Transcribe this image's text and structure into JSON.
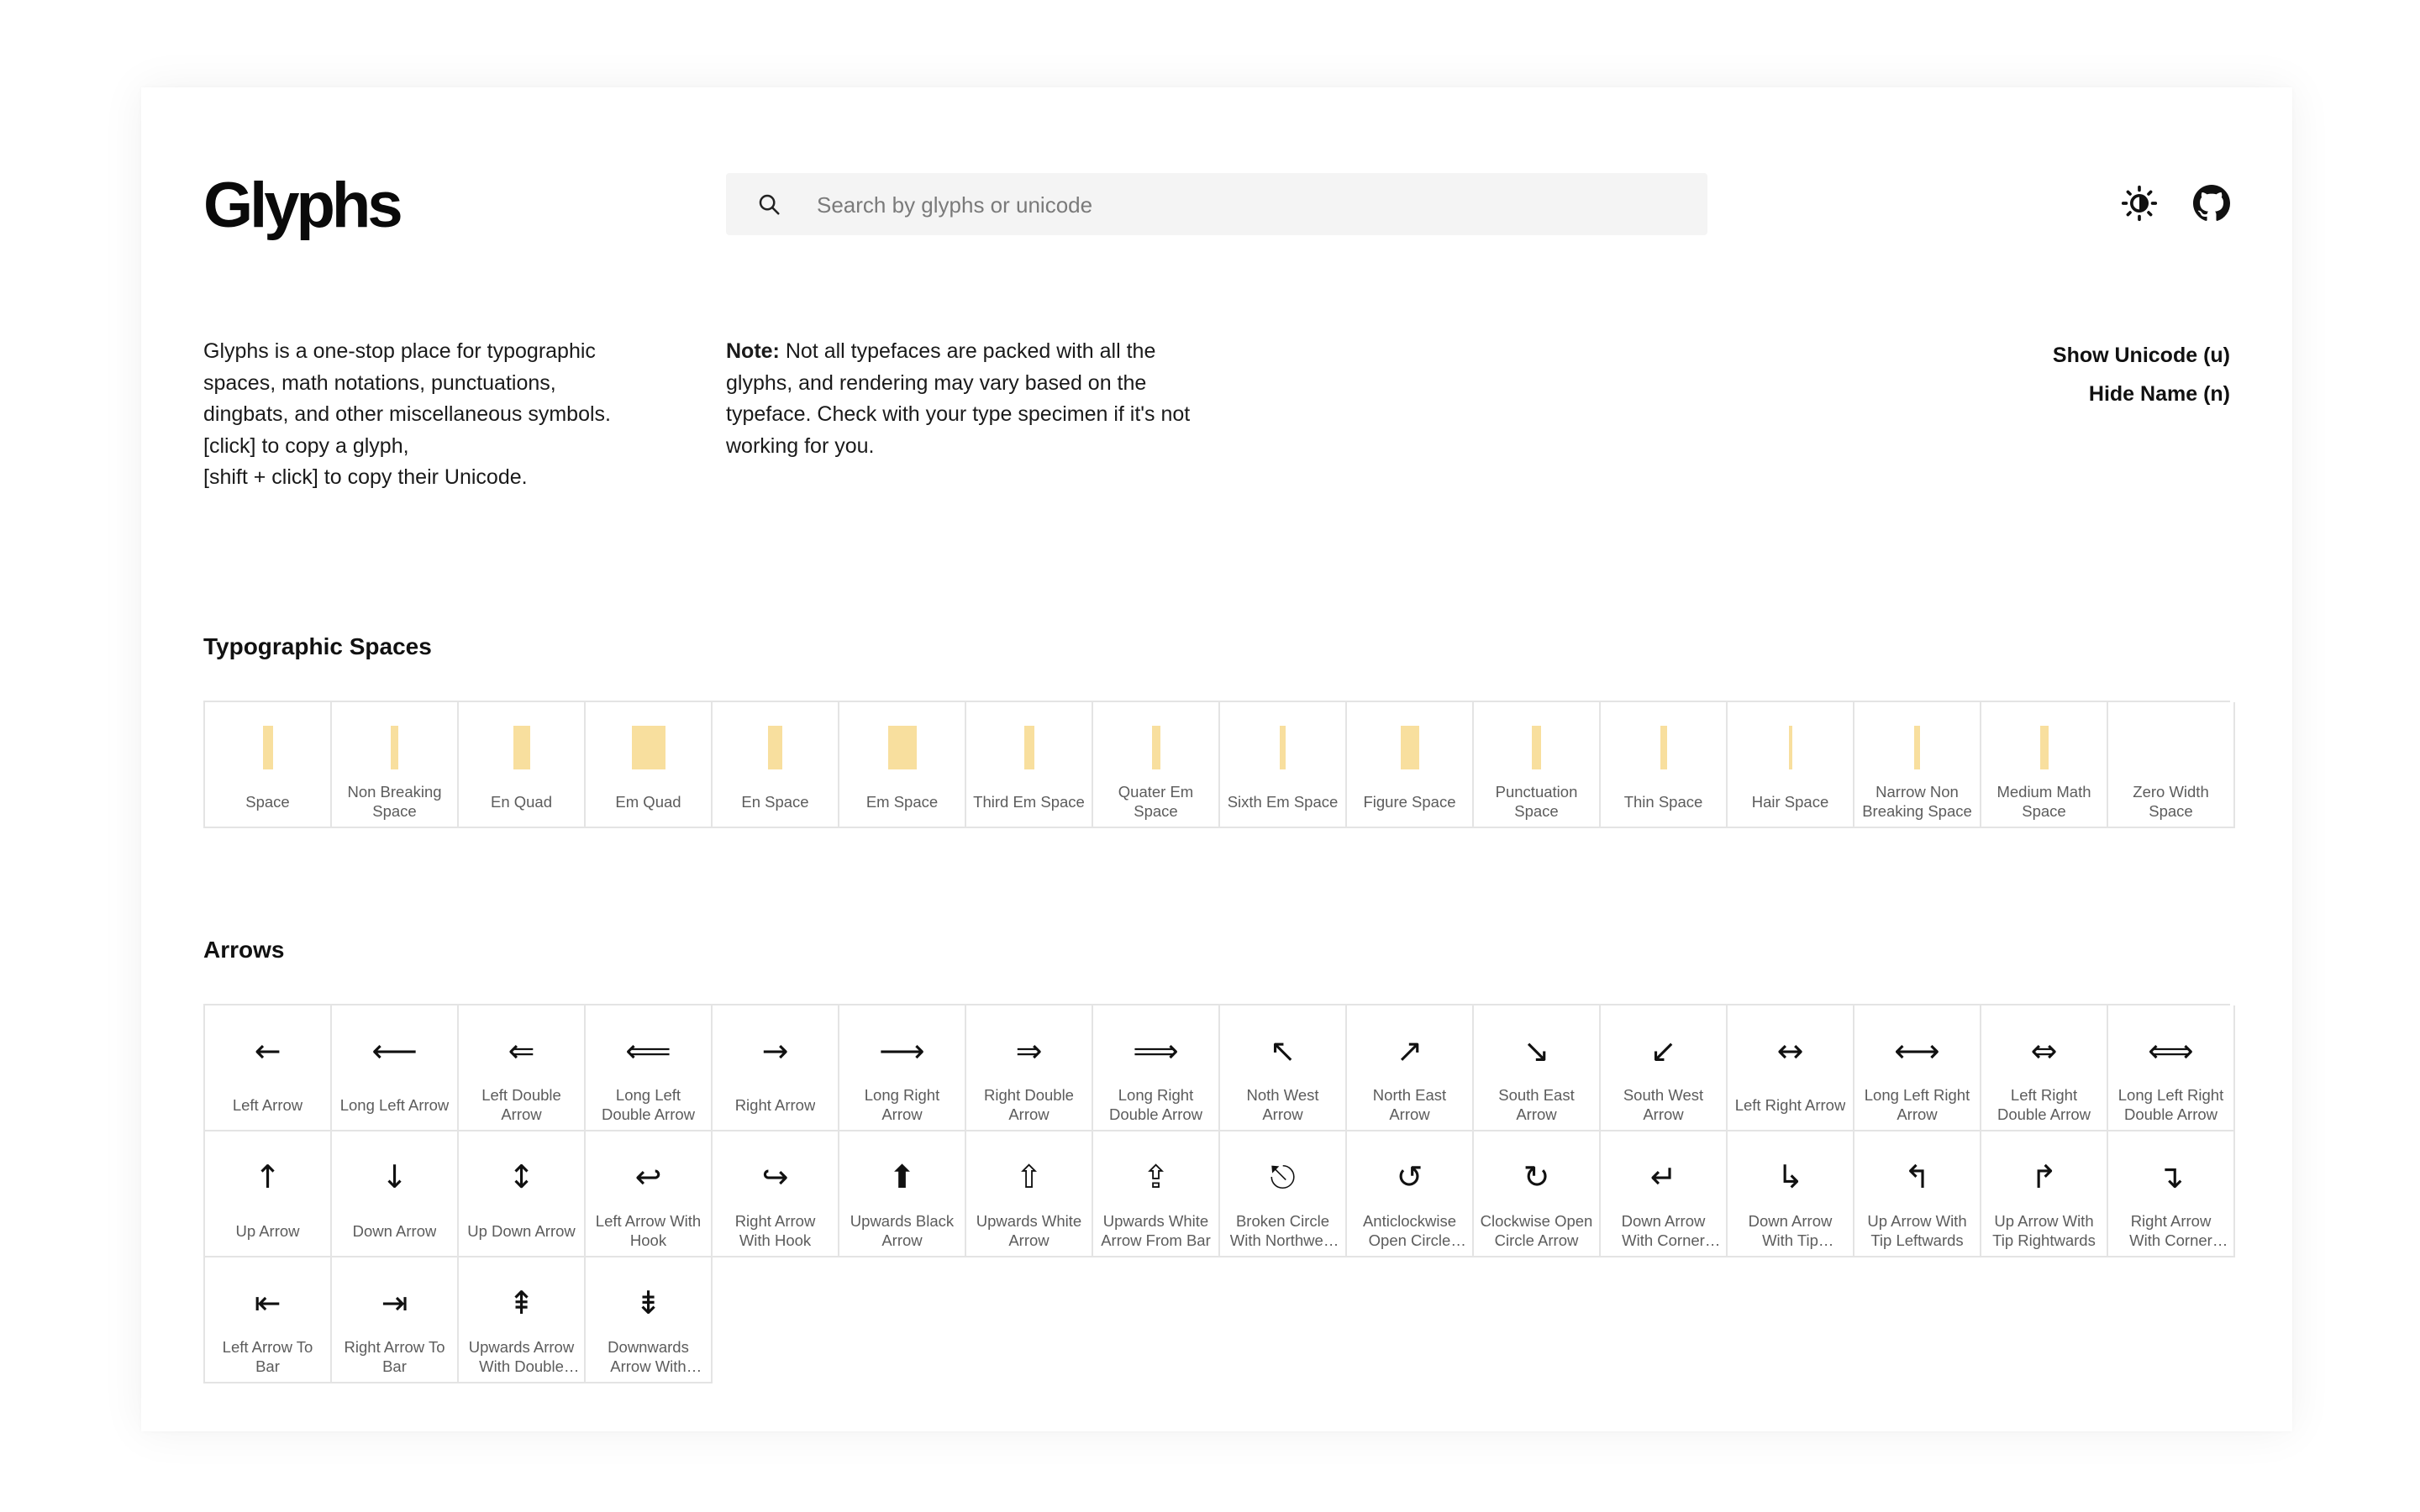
{
  "app": {
    "logo": "Glyphs"
  },
  "search": {
    "placeholder": "Search by glyphs or unicode"
  },
  "header": {
    "theme_icon": "sun-contrast-icon",
    "github_icon": "github-icon"
  },
  "intro": {
    "lines": [
      "Glyphs is a one-stop place for typographic",
      "spaces, math notations, punctuations,",
      "dingbats, and other miscellaneous symbols.",
      "[click] to copy a glyph,",
      "[shift + click] to copy their Unicode."
    ]
  },
  "note": {
    "label": "Note:",
    "text": "Not all typefaces are packed with all the glyphs, and rendering may vary based on the typeface. Check with your type specimen if it's not working for you."
  },
  "toggles": {
    "show_unicode": "Show Unicode (u)",
    "hide_name": "Hide Name (n)"
  },
  "colors": {
    "space_fill": "#f8df9e",
    "grid_border": "#e4e4e4"
  },
  "sections": [
    {
      "title": "Typographic Spaces",
      "kind": "spaces",
      "items": [
        {
          "name": "Space",
          "glyph": " "
        },
        {
          "name": "Non Breaking Space",
          "glyph": " "
        },
        {
          "name": "En Quad",
          "glyph": " "
        },
        {
          "name": "Em Quad",
          "glyph": " "
        },
        {
          "name": "En Space",
          "glyph": " "
        },
        {
          "name": "Em Space",
          "glyph": " "
        },
        {
          "name": "Third Em Space",
          "glyph": " "
        },
        {
          "name": "Quater Em Space",
          "glyph": " "
        },
        {
          "name": "Sixth Em Space",
          "glyph": " "
        },
        {
          "name": "Figure Space",
          "glyph": " "
        },
        {
          "name": "Punctuation Space",
          "glyph": " "
        },
        {
          "name": "Thin Space",
          "glyph": " "
        },
        {
          "name": "Hair Space",
          "glyph": " "
        },
        {
          "name": "Narrow Non Breaking Space",
          "glyph": " "
        },
        {
          "name": "Medium Math Space",
          "glyph": " "
        },
        {
          "name": "Zero Width Space",
          "glyph": "​"
        }
      ]
    },
    {
      "title": "Arrows",
      "kind": "glyphs",
      "items": [
        {
          "name": "Left Arrow",
          "glyph": "←"
        },
        {
          "name": "Long Left Arrow",
          "glyph": "⟵"
        },
        {
          "name": "Left Double Arrow",
          "glyph": "⇐"
        },
        {
          "name": "Long Left Double Arrow",
          "glyph": "⟸"
        },
        {
          "name": "Right Arrow",
          "glyph": "→"
        },
        {
          "name": "Long Right Arrow",
          "glyph": "⟶"
        },
        {
          "name": "Right Double Arrow",
          "glyph": "⇒"
        },
        {
          "name": "Long Right Double Arrow",
          "glyph": "⟹"
        },
        {
          "name": "Noth West Arrow",
          "glyph": "↖"
        },
        {
          "name": "North East Arrow",
          "glyph": "↗"
        },
        {
          "name": "South East Arrow",
          "glyph": "↘"
        },
        {
          "name": "South West Arrow",
          "glyph": "↙"
        },
        {
          "name": "Left Right Arrow",
          "glyph": "↔"
        },
        {
          "name": "Long Left Right Arrow",
          "glyph": "⟷"
        },
        {
          "name": "Left Right Double Arrow",
          "glyph": "⇔"
        },
        {
          "name": "Long Left Right Double Arrow",
          "glyph": "⟺"
        },
        {
          "name": "Up Arrow",
          "glyph": "↑"
        },
        {
          "name": "Down Arrow",
          "glyph": "↓"
        },
        {
          "name": "Up Down Arrow",
          "glyph": "↕"
        },
        {
          "name": "Left Arrow With Hook",
          "glyph": "↩"
        },
        {
          "name": "Right Arrow With Hook",
          "glyph": "↪"
        },
        {
          "name": "Upwards Black Arrow",
          "glyph": "⬆"
        },
        {
          "name": "Upwards White Arrow",
          "glyph": "⇧"
        },
        {
          "name": "Upwards White Arrow From Bar",
          "glyph": "⇪"
        },
        {
          "name": "Broken Circle With Northwest Arrow",
          "glyph": "⎋"
        },
        {
          "name": "Anticlockwise Open Circle Arrow",
          "glyph": "↺"
        },
        {
          "name": "Clockwise Open Circle Arrow",
          "glyph": "↻"
        },
        {
          "name": "Down Arrow With Corner Leftwards",
          "glyph": "↵"
        },
        {
          "name": "Down Arrow With Tip Rightwards",
          "glyph": "↳"
        },
        {
          "name": "Up Arrow With Tip Leftwards",
          "glyph": "↰"
        },
        {
          "name": "Up Arrow With Tip Rightwards",
          "glyph": "↱"
        },
        {
          "name": "Right Arrow With Corner Downwards",
          "glyph": "↴"
        },
        {
          "name": "Left Arrow To Bar",
          "glyph": "⇤"
        },
        {
          "name": "Right Arrow To Bar",
          "glyph": "⇥"
        },
        {
          "name": "Upwards Arrow With Double Stroke",
          "glyph": "⇞"
        },
        {
          "name": "Downwards Arrow With Double Stroke",
          "glyph": "⇟"
        }
      ]
    }
  ]
}
